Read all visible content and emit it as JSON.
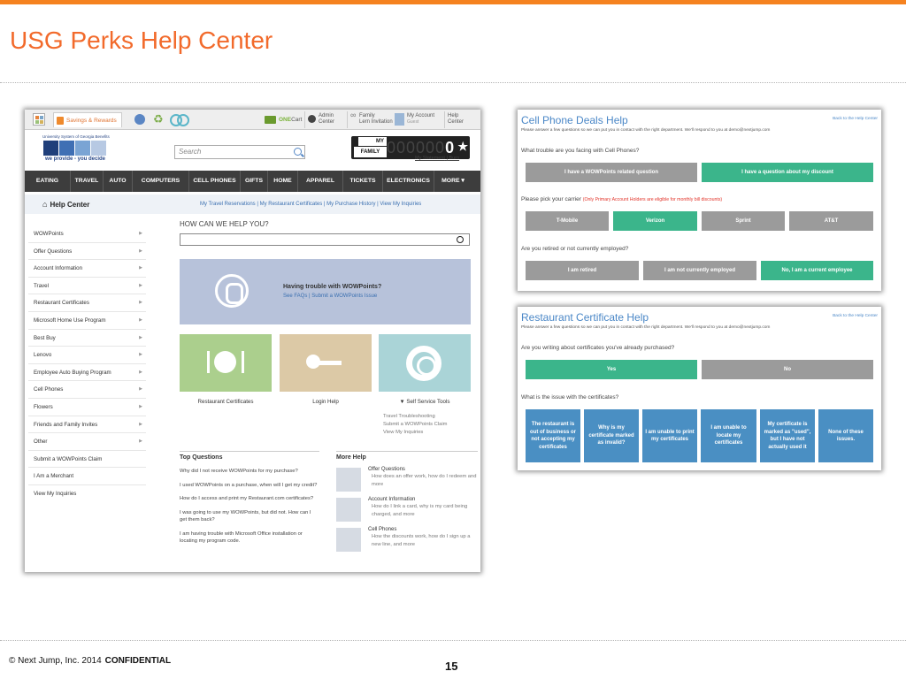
{
  "slide": {
    "title": "USG Perks Help Center",
    "footer_copyright": "© Next Jump, Inc. 2014",
    "footer_confidential": "CONFIDENTIAL",
    "page_number": "15",
    "accent_color": "#f26a2b"
  },
  "portal": {
    "toolbar": {
      "savings_tab": "Savings & Rewards",
      "onecart_prefix": "ONE",
      "onecart_suffix": "Cart",
      "admin_line1": "Admin",
      "admin_line2": "Center",
      "family_line1": "Family",
      "family_line2": "Lern Invitation",
      "account_line1": "My Account",
      "account_line2": "Guest",
      "help_line1": "Help",
      "help_line2": "Center"
    },
    "logo": {
      "top_text": "University System of Georgia Benefits",
      "slogan": "we provide - you decide"
    },
    "search_placeholder": "Search",
    "counter": {
      "my_label": "MY",
      "family_label": "FAMILY",
      "digits": "000000",
      "last_digit": "0",
      "my_statement": "My Statement",
      "separator": "|",
      "burn": "Burn"
    },
    "nav": [
      "EATING",
      "TRAVEL",
      "AUTO",
      "COMPUTERS",
      "CELL PHONES",
      "GIFTS",
      "HOME",
      "APPAREL",
      "TICKETS",
      "ELECTRONICS",
      "MORE ▾"
    ],
    "help_center": {
      "title": "Help Center",
      "links": "My Travel Reservations  |  My Restaurant Certificates  |  My Purchase History  |  View My Inquiries"
    },
    "sidebar": [
      {
        "label": "WOWPoints",
        "arrow": true
      },
      {
        "label": "Offer Questions",
        "arrow": true
      },
      {
        "label": "Account Information",
        "arrow": true
      },
      {
        "label": "Travel",
        "arrow": true
      },
      {
        "label": "Restaurant Certificates",
        "arrow": true
      },
      {
        "label": "Microsoft Home Use Program",
        "arrow": true
      },
      {
        "label": "Best Buy",
        "arrow": true
      },
      {
        "label": "Lenovo",
        "arrow": true
      },
      {
        "label": "Employee Auto Buying Program",
        "arrow": true
      },
      {
        "label": "Cell Phones",
        "arrow": true
      },
      {
        "label": "Flowers",
        "arrow": true
      },
      {
        "label": "Friends and Family Invites",
        "arrow": true
      },
      {
        "label": "Other",
        "arrow": true
      },
      {
        "label": "Submit a WOWPoints Claim",
        "arrow": false
      },
      {
        "label": "I Am a Merchant",
        "arrow": false
      },
      {
        "label": "View My Inquiries",
        "arrow": false
      }
    ],
    "how_title": "HOW CAN WE HELP YOU?",
    "banner": {
      "title": "Having trouble with WOWPoints?",
      "links": "See FAQs  |  Submit a WOWPoints Issue"
    },
    "tiles": {
      "restaurant": "Restaurant Certificates",
      "login": "Login Help",
      "self_service": "▼  Self Service Tools",
      "self_service_items": [
        "Travel Troubleshooting",
        "Submit a WOWPoints Claim",
        "View My Inquiries"
      ]
    },
    "top_questions": {
      "title": "Top Questions",
      "items": [
        "Why did I not receive WOWPoints for my purchase?",
        "I used WOWPoints on a purchase, when will I get my credit?",
        "How do I access and print my Restaurant.com certificates?",
        "I was going to use my WOWPoints, but did not. How can I get them back?",
        "I am having trouble with Microsoft Office installation or locating my program code."
      ]
    },
    "more_help": {
      "title": "More Help",
      "items": [
        {
          "title": "Offer Questions",
          "desc": "How does an offer work, how do I redeem and more"
        },
        {
          "title": "Account Information",
          "desc": "How do I link a card, why is my card being charged, and more"
        },
        {
          "title": "Cell Phones",
          "desc": "How the discounts work, how do I sign up a new line, and more"
        }
      ]
    }
  },
  "cell_panel": {
    "title": "Cell Phone Deals Help",
    "back": "Back to the Help Center",
    "subtitle": "Please answer a few questions so we can put you in contact with the right department. We'll respond to you at demo@nextjump.com",
    "q1": "What trouble are you facing with Cell Phones?",
    "q1_options": [
      "I have a WOWPoints related question",
      "I have a question about my discount"
    ],
    "q2": "Please pick your carrier",
    "q2_note": "(Only Primary Account Holders are eligible for monthly bill discounts)",
    "carriers": [
      "T-Mobile",
      "Verizon",
      "Sprint",
      "AT&T"
    ],
    "q3": "Are you retired or not currently employed?",
    "q3_options": [
      "I am retired",
      "I am not currently employed",
      "No, I am a current employee"
    ]
  },
  "restaurant_panel": {
    "title": "Restaurant Certificate Help",
    "back": "Back to the Help Center",
    "subtitle": "Please answer a few questions so we can put you in contact with the right department. We'll respond to you at demo@nextjump.com",
    "q1": "Are you writing about certificates you've already purchased?",
    "q1_options": [
      "Yes",
      "No"
    ],
    "q2": "What is the issue with the certificates?",
    "issues": [
      "The restaurant is out of business or not accepting my certificates",
      "Why is my certificate marked as invalid?",
      "I am unable to print my certificates",
      "I am unable to locate my certificates",
      "My certificate is marked as \"used\", but I have not actually used it",
      "None of these issues."
    ]
  }
}
